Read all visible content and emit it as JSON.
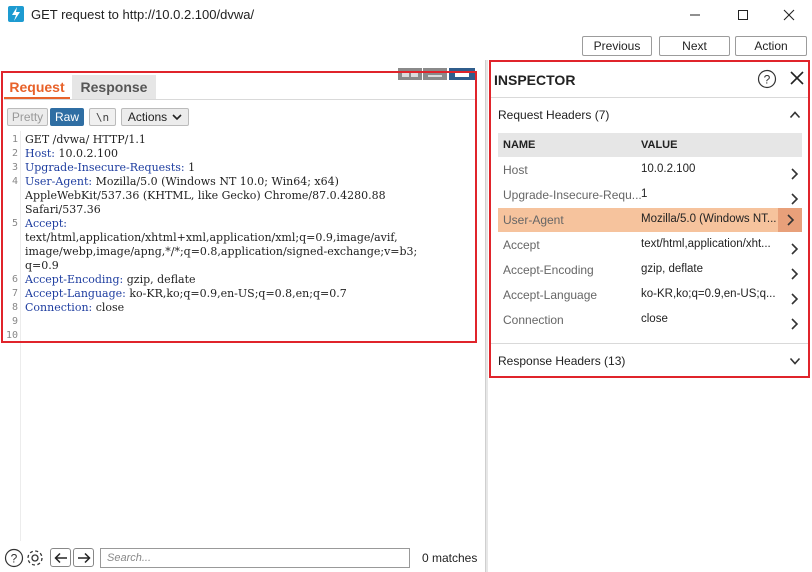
{
  "window": {
    "title": "GET request to http://10.0.2.100/dvwa/"
  },
  "toolbar": {
    "previous_label": "Previous",
    "next_label": "Next",
    "action_label": "Action"
  },
  "tabs": {
    "request_label": "Request",
    "response_label": "Response"
  },
  "editor_buttons": {
    "pretty_label": "Pretty",
    "raw_label": "Raw",
    "newline_label": "\\n",
    "actions_label": "Actions"
  },
  "request_lines": [
    {
      "num": "1",
      "name": "GET /dvwa/ HTTP/1.1",
      "value": ""
    },
    {
      "num": "2",
      "name": "Host:",
      "value": " 10.0.2.100"
    },
    {
      "num": "3",
      "name": "Upgrade-Insecure-Requests:",
      "value": " 1"
    },
    {
      "num": "4",
      "name": "User-Agent:",
      "value": " Mozilla/5.0 (Windows NT 10.0; Win64; x64)"
    },
    {
      "num": "",
      "name": "",
      "value": "AppleWebKit/537.36 (KHTML, like Gecko) Chrome/87.0.4280.88"
    },
    {
      "num": "",
      "name": "",
      "value": "Safari/537.36"
    },
    {
      "num": "5",
      "name": "Accept:",
      "value": ""
    },
    {
      "num": "",
      "name": "",
      "value": "text/html,application/xhtml+xml,application/xml;q=0.9,image/avif,"
    },
    {
      "num": "",
      "name": "",
      "value": "image/webp,image/apng,*/*;q=0.8,application/signed-exchange;v=b3;"
    },
    {
      "num": "",
      "name": "",
      "value": "q=0.9"
    },
    {
      "num": "6",
      "name": "Accept-Encoding:",
      "value": " gzip, deflate"
    },
    {
      "num": "7",
      "name": "Accept-Language:",
      "value": " ko-KR,ko;q=0.9,en-US;q=0.8,en;q=0.7"
    },
    {
      "num": "8",
      "name": "Connection:",
      "value": " close"
    },
    {
      "num": "9",
      "name": "",
      "value": ""
    },
    {
      "num": "10",
      "name": "",
      "value": ""
    }
  ],
  "search": {
    "placeholder": "Search...",
    "matches": "0 matches"
  },
  "inspector": {
    "title": "INSPECTOR",
    "request_headers_title": "Request Headers (7)",
    "col_name": "NAME",
    "col_value": "VALUE",
    "headers": [
      {
        "name": "Host",
        "value": "10.0.2.100"
      },
      {
        "name": "Upgrade-Insecure-Requ...",
        "value": "1"
      },
      {
        "name": "User-Agent",
        "value": "Mozilla/5.0 (Windows NT..."
      },
      {
        "name": "Accept",
        "value": "text/html,application/xht..."
      },
      {
        "name": "Accept-Encoding",
        "value": "gzip, deflate"
      },
      {
        "name": "Accept-Language",
        "value": "ko-KR,ko;q=0.9,en-US;q..."
      },
      {
        "name": "Connection",
        "value": "close"
      }
    ],
    "selected_header": "User-Agent",
    "response_headers_title": "Response Headers (13)"
  },
  "colors": {
    "accent_orange": "#e8622a",
    "selected_row": "#f6c39d",
    "highlight_border": "#e0242b",
    "raw_button": "#2f6ea3",
    "header_name": "#1f3ea0"
  }
}
